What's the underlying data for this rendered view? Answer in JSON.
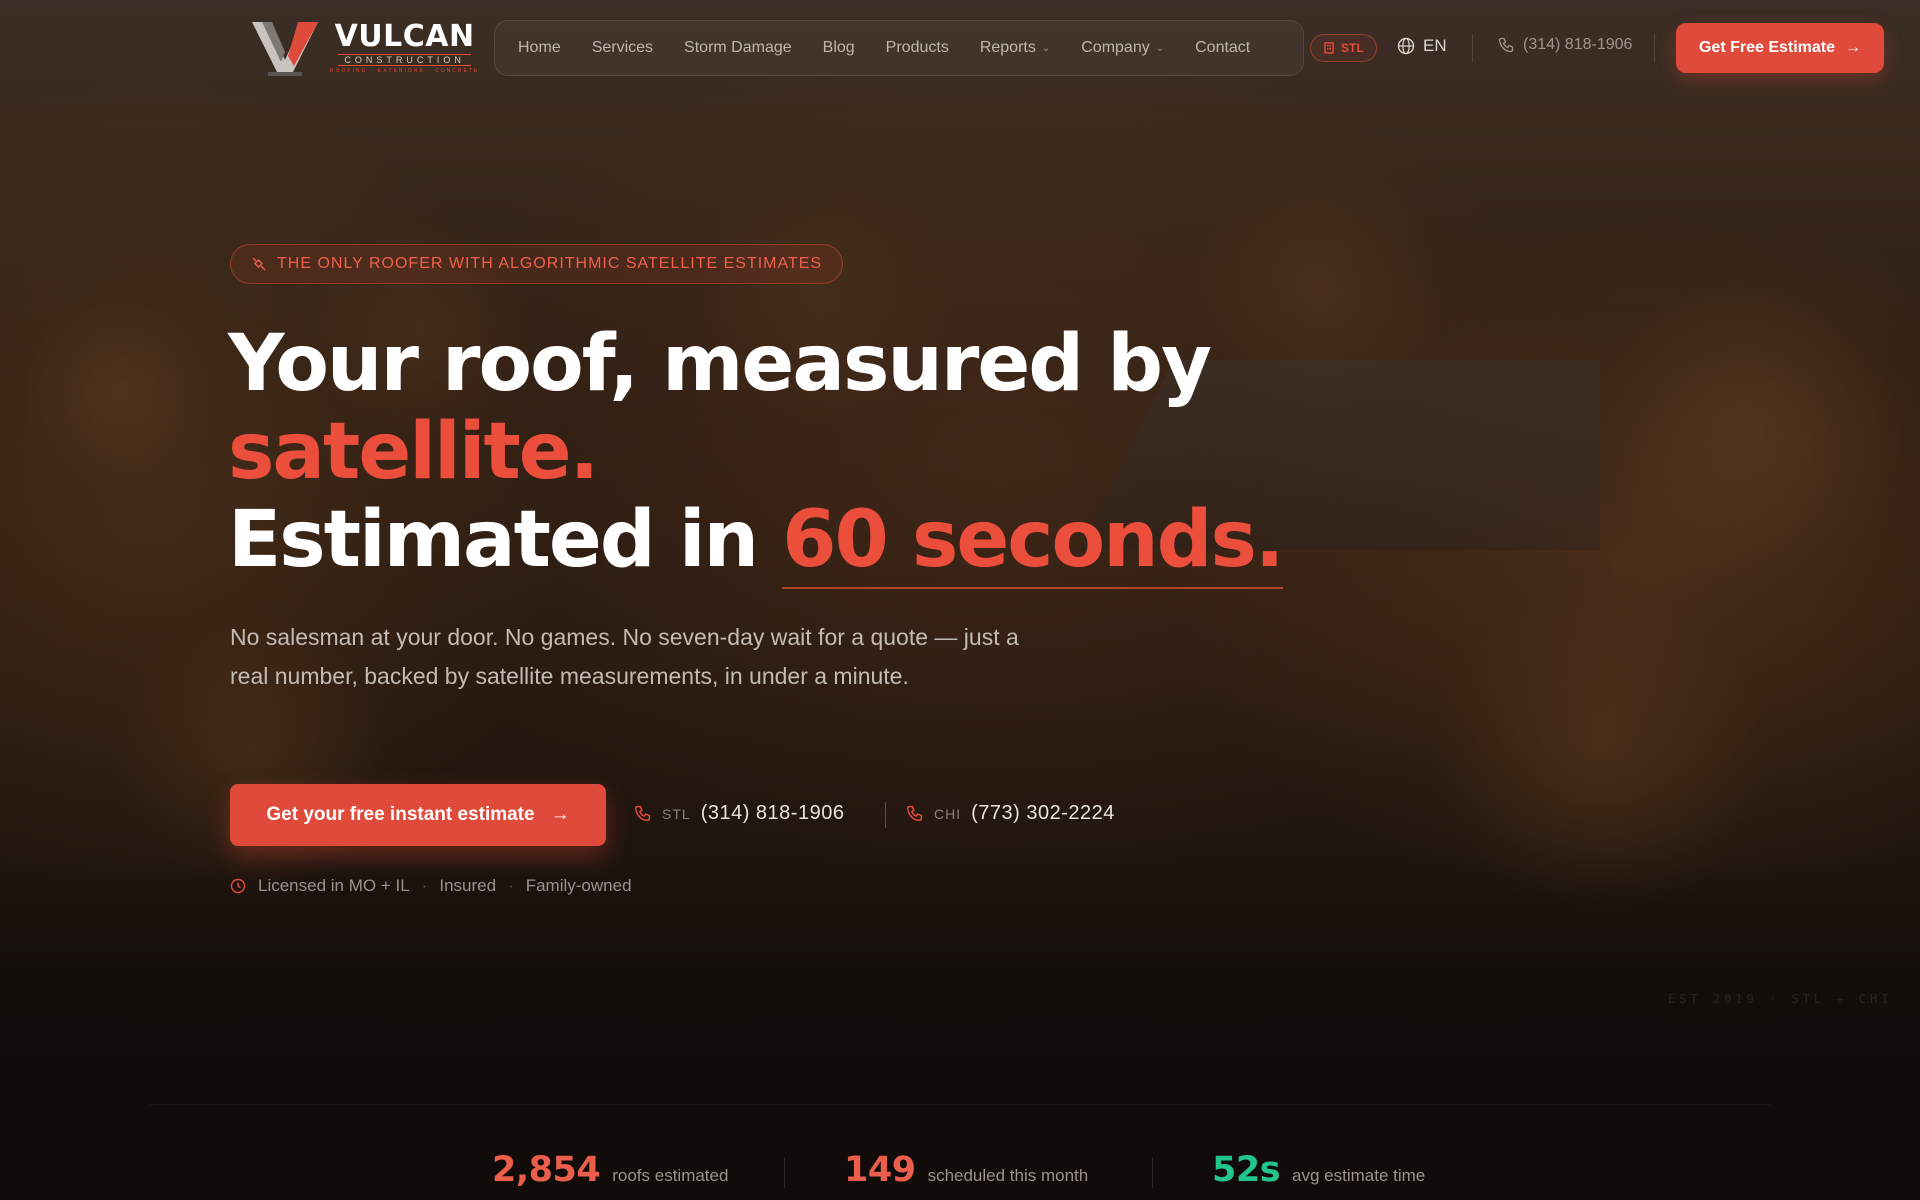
{
  "brand": {
    "name": "VULCAN",
    "sub": "CONSTRUCTION",
    "tagline": "ROOFING · EXTERIORS · CONCRETE"
  },
  "nav": {
    "links": [
      "Home",
      "Services",
      "Storm Damage",
      "Blog",
      "Products",
      "Reports",
      "Company",
      "Contact"
    ],
    "city_badge": "STL",
    "language": "EN",
    "phone": "(314) 818-1906",
    "cta": "Get Free Estimate"
  },
  "hero": {
    "eyebrow": "THE ONLY ROOFER WITH ALGORITHMIC SATELLITE ESTIMATES",
    "headline_line1": "Your roof, measured by",
    "headline_accent1": "satellite.",
    "headline_line3_prefix": "Estimated in",
    "headline_accent2": "60 seconds.",
    "subcopy": "No salesman at your door. No games. No seven-day wait for a quote — just a real number, backed by satellite measurements, in under a minute.",
    "cta": "Get your free instant estimate",
    "phones": [
      {
        "city": "STL",
        "number": "(314) 818-1906"
      },
      {
        "city": "CHI",
        "number": "(773) 302-2224"
      }
    ],
    "trust": [
      "Licensed in MO + IL",
      "Insured",
      "Family-owned"
    ],
    "established": "EST 2019 · STL + CHI"
  },
  "stats": [
    {
      "value": "2,854",
      "label": "roofs estimated",
      "color": "#ec5e4c"
    },
    {
      "value": "149",
      "label": "scheduled this month",
      "color": "#ec5e4c"
    },
    {
      "value": "52s",
      "label": "avg estimate time",
      "color": "#22c58b"
    }
  ],
  "colors": {
    "accent": "#e04a3a",
    "success": "#22c58b"
  }
}
